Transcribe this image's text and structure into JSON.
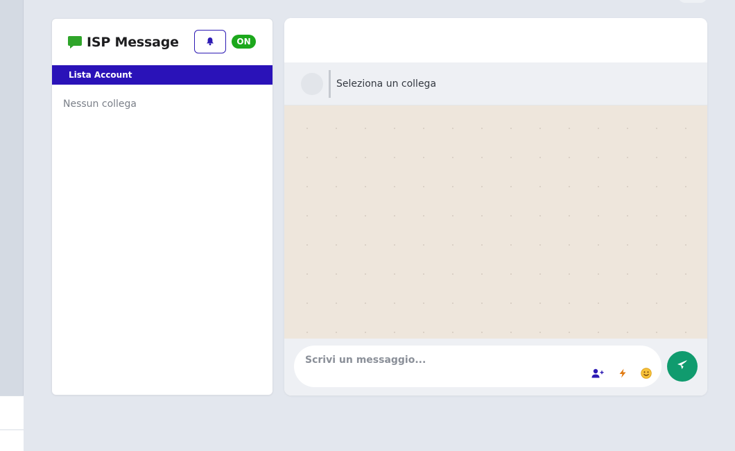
{
  "sidebar": {
    "title": "ISP Message",
    "status_badge": "ON",
    "section_label": "Lista Account",
    "empty_text": "Nessun collega",
    "icons": {
      "chat": "chat-bubble-icon",
      "bell": "bell-icon"
    }
  },
  "chat": {
    "header_text": "Seleziona un collega",
    "input_placeholder": "Scrivi un messaggio...",
    "tools": [
      "add-user-icon",
      "lightning-icon",
      "emoji-icon"
    ],
    "send_icon": "paper-plane-icon"
  },
  "colors": {
    "accent": "#2a12b8",
    "status_on": "#1ca81c",
    "send": "#109b6e",
    "chat_bg": "#eee6dc",
    "chat_icon": "#2fa52a"
  }
}
